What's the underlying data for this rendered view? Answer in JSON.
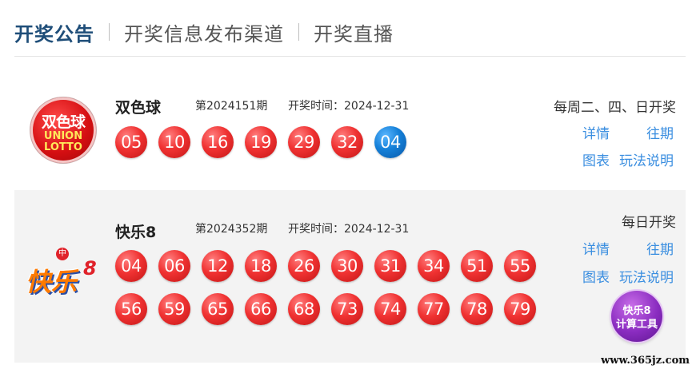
{
  "tabs": [
    "开奖公告",
    "开奖信息发布渠道",
    "开奖直播"
  ],
  "colors": {
    "accent": "#1f4e79",
    "link": "#3a8ee0",
    "red_ball": "#e8272d",
    "blue_ball": "#1580d8",
    "card_bg": "#f3f3f3"
  },
  "ssq": {
    "logo_icon": "union-lotto-logo",
    "logo_cn": "双色球",
    "logo_en1": "UNION",
    "logo_en2": "LOTTO",
    "name": "双色球",
    "issue": "第2024151期",
    "time": "开奖时间：2024-12-31",
    "schedule": "每周二、四、日开奖",
    "red": [
      "05",
      "10",
      "16",
      "19",
      "29",
      "32"
    ],
    "blue": "04",
    "links": {
      "detail": "详情",
      "history": "往期",
      "chart": "图表",
      "rules": "玩法说明"
    }
  },
  "kl8": {
    "logo_icon": "kuaile8-logo",
    "logo_text": "快乐",
    "logo_num": "8",
    "name": "快乐8",
    "issue": "第2024352期",
    "time": "开奖时间：2024-12-31",
    "schedule": "每日开奖",
    "numbers": [
      "04",
      "06",
      "12",
      "18",
      "26",
      "30",
      "31",
      "34",
      "51",
      "55",
      "56",
      "59",
      "65",
      "66",
      "68",
      "73",
      "74",
      "77",
      "78",
      "79"
    ],
    "links": {
      "detail": "详情",
      "history": "往期",
      "chart": "图表",
      "rules": "玩法说明"
    },
    "tool_line1": "快乐8",
    "tool_line2": "计算工具"
  },
  "watermark": "www.365jz.com"
}
